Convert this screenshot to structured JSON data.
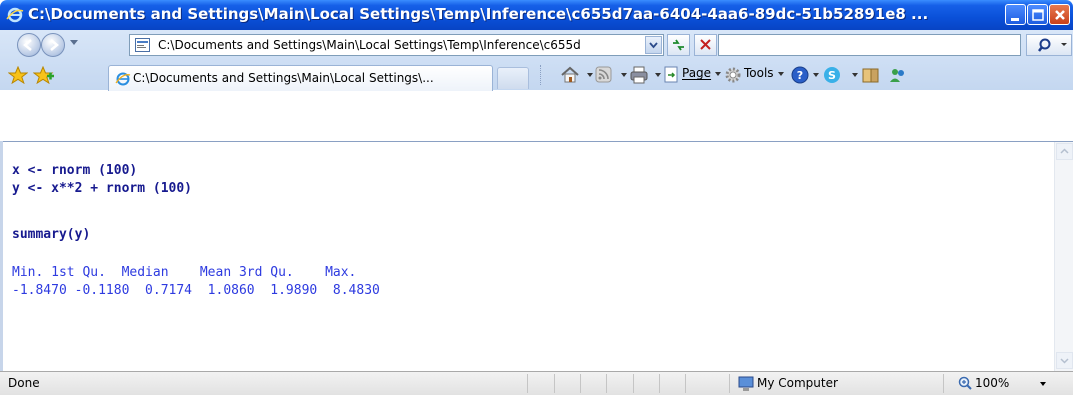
{
  "window": {
    "title": "C:\\Documents and Settings\\Main\\Local Settings\\Temp\\Inference\\c655d7aa-6404-4aa6-89dc-51b52891e8 ..."
  },
  "address_bar": {
    "url": "C:\\Documents and Settings\\Main\\Local Settings\\Temp\\Inference\\c655d",
    "search_placeholder": ""
  },
  "tabs": [
    {
      "label": "C:\\Documents and Settings\\Main\\Local Settings\\..."
    }
  ],
  "command_bar": {
    "page_label": "Page",
    "tools_label": "Tools"
  },
  "content": {
    "lines": [
      "x <- rnorm (100)",
      "y <- x**2 + rnorm (100)",
      "summary(y)",
      "Min. 1st Qu.  Median    Mean 3rd Qu.    Max.",
      "-1.8470 -0.1180  0.7174  1.0860  1.9890  8.4830"
    ]
  },
  "status_bar": {
    "status": "Done",
    "zone": "My Computer",
    "zoom": "100%"
  },
  "colors": {
    "title_bar": "#0a50d8",
    "code_input": "#171a8f",
    "code_output": "#2e3be0"
  }
}
